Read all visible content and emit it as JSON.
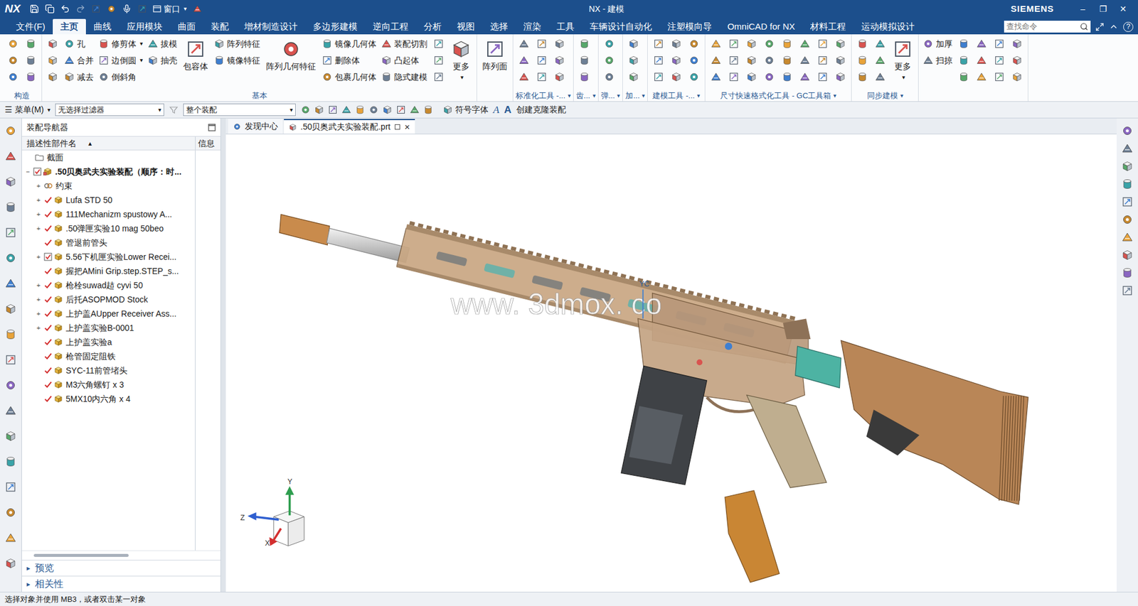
{
  "caret": "▾",
  "window": {
    "logo": "NX",
    "title": "NX - 建模",
    "brand": "SIEMENS",
    "window_menu": "窗口",
    "controls": [
      "–",
      "❐",
      "✕"
    ]
  },
  "tabs": [
    {
      "label": "文件(F)",
      "selected": false
    },
    {
      "label": "主页",
      "selected": true
    },
    {
      "label": "曲线",
      "selected": false
    },
    {
      "label": "应用模块",
      "selected": false
    },
    {
      "label": "曲面",
      "selected": false
    },
    {
      "label": "装配",
      "selected": false
    },
    {
      "label": "增材制造设计",
      "selected": false
    },
    {
      "label": "多边形建模",
      "selected": false
    },
    {
      "label": "逆向工程",
      "selected": false
    },
    {
      "label": "分析",
      "selected": false
    },
    {
      "label": "视图",
      "selected": false
    },
    {
      "label": "选择",
      "selected": false
    },
    {
      "label": "渲染",
      "selected": false
    },
    {
      "label": "工具",
      "selected": false
    },
    {
      "label": "车辆设计自动化",
      "selected": false
    },
    {
      "label": "注塑模向导",
      "selected": false
    },
    {
      "label": "OmniCAD for NX",
      "selected": false
    },
    {
      "label": "材料工程",
      "selected": false
    },
    {
      "label": "运动模拟设计",
      "selected": false
    }
  ],
  "search": {
    "placeholder": "查找命令",
    "help": "?"
  },
  "ribbon": {
    "groups": [
      {
        "label": "构造",
        "columns": [
          {
            "kind": "icons"
          },
          {
            "kind": "icons"
          }
        ]
      },
      {
        "label": "基本",
        "columns": [
          {
            "kind": "icons"
          },
          {
            "kind": "small",
            "items": [
              {
                "label": "孔"
              },
              {
                "label": "合并"
              },
              {
                "label": "减去"
              }
            ]
          },
          {
            "kind": "small",
            "items": [
              {
                "label": "修剪体",
                "dropdown": true
              },
              {
                "label": "边倒圆",
                "dropdown": true
              },
              {
                "label": "倒斜角"
              }
            ]
          },
          {
            "kind": "small",
            "items": [
              {
                "label": "拔模"
              },
              {
                "label": "抽壳"
              }
            ]
          },
          {
            "kind": "large",
            "label": "包容体"
          },
          {
            "kind": "small",
            "items": [
              {
                "label": "阵列特征"
              },
              {
                "label": "镜像特征"
              }
            ]
          },
          {
            "kind": "large",
            "label": "阵列几何特征"
          },
          {
            "kind": "small",
            "items": [
              {
                "label": "镜像几何体"
              },
              {
                "label": "删除体"
              },
              {
                "label": "包裹几何体"
              }
            ]
          },
          {
            "kind": "small",
            "items": [
              {
                "label": "装配切割"
              },
              {
                "label": "凸起体"
              },
              {
                "label": "隐式建模"
              }
            ]
          },
          {
            "kind": "icons"
          },
          {
            "kind": "large",
            "label": "更多",
            "dropdown": true
          }
        ]
      },
      {
        "columns": [
          {
            "kind": "large",
            "label": "阵列面"
          }
        ]
      },
      {
        "label": "标准化工具 -...",
        "dropdown": true,
        "columns": [
          {
            "kind": "icons"
          },
          {
            "kind": "icons"
          },
          {
            "kind": "icons"
          }
        ]
      },
      {
        "label": "齿...",
        "dropdown": true,
        "columns": [
          {
            "kind": "icons"
          }
        ]
      },
      {
        "label": "弹...",
        "dropdown": true,
        "columns": [
          {
            "kind": "icons"
          }
        ]
      },
      {
        "label": "加...",
        "dropdown": true,
        "columns": [
          {
            "kind": "icons"
          }
        ]
      },
      {
        "label": "建模工具 -...",
        "dropdown": true,
        "columns": [
          {
            "kind": "icons"
          },
          {
            "kind": "icons"
          },
          {
            "kind": "icons"
          }
        ]
      },
      {
        "label": "尺寸快速格式化工具 - GC工具箱",
        "dropdown": true,
        "columns": [
          {
            "kind": "icons"
          },
          {
            "kind": "icons"
          },
          {
            "kind": "icons"
          },
          {
            "kind": "icons"
          },
          {
            "kind": "icons"
          },
          {
            "kind": "icons"
          },
          {
            "kind": "icons"
          },
          {
            "kind": "icons"
          }
        ]
      },
      {
        "label": "同步建模",
        "dropdown": true,
        "columns": [
          {
            "kind": "icons"
          },
          {
            "kind": "icons"
          },
          {
            "kind": "large",
            "label": "更多",
            "dropdown": true
          }
        ]
      },
      {
        "columns": [
          {
            "kind": "small",
            "items": [
              {
                "label": "加厚"
              },
              {
                "label": "扫掠"
              }
            ]
          },
          {
            "kind": "icons"
          },
          {
            "kind": "icons"
          },
          {
            "kind": "icons"
          },
          {
            "kind": "icons"
          }
        ]
      }
    ]
  },
  "toolbar": {
    "menu_icon": "☰",
    "menu": "菜单(M)",
    "filters": [
      "无选择过滤器",
      "整个装配"
    ],
    "symbol_font": "符号字体",
    "font_icons": [
      "A",
      "A"
    ],
    "clone": "创建克隆装配"
  },
  "documents": [
    {
      "label": "发现中心",
      "selected": false
    },
    {
      "label": ".50贝奥武夫实验装配.prt",
      "selected": true,
      "close": "✕"
    }
  ],
  "navigator": {
    "title": "装配导航器",
    "columns": [
      "描述性部件名",
      "信息"
    ],
    "sort": "▲",
    "rows": [
      {
        "label": "截面",
        "level": 1,
        "kind": "folder",
        "check": "none",
        "bold": false
      },
      {
        "label": ".50贝奥武夫实验装配（顺序：时...",
        "level": 0,
        "expander": "−",
        "kind": "assembly",
        "check": "box",
        "bold": true
      },
      {
        "label": "约束",
        "level": 1,
        "expander": "+",
        "kind": "constraint",
        "check": "none",
        "bold": false
      },
      {
        "label": "Lufa STD 50",
        "level": 1,
        "expander": "+",
        "kind": "part",
        "check": "tick",
        "bold": false
      },
      {
        "label": "111Mechanizm spustowy A...",
        "level": 1,
        "expander": "+",
        "kind": "part",
        "check": "tick",
        "bold": false
      },
      {
        "label": ".50弹匣实验10 mag 50beo",
        "level": 1,
        "expander": "+",
        "kind": "part",
        "check": "tick",
        "bold": false
      },
      {
        "label": "管退前管头",
        "level": 1,
        "kind": "part",
        "check": "tick",
        "bold": false
      },
      {
        "label": "5.56下机匣实验Lower Recei...",
        "level": 1,
        "expander": "+",
        "kind": "part",
        "check": "box",
        "bold": false
      },
      {
        "label": "握把AMini Grip.step.STEP_s...",
        "level": 1,
        "kind": "part",
        "check": "tick",
        "bold": false
      },
      {
        "label": "枪栓suwad趌 cyvi 50",
        "level": 1,
        "expander": "+",
        "kind": "part",
        "check": "tick",
        "bold": false
      },
      {
        "label": "后托ASOPMOD Stock",
        "level": 1,
        "expander": "+",
        "kind": "part",
        "check": "tick",
        "bold": false
      },
      {
        "label": "上护盖AUpper Receiver Ass...",
        "level": 1,
        "expander": "+",
        "kind": "part",
        "check": "tick",
        "bold": false
      },
      {
        "label": "上护盖实验B-0001",
        "level": 1,
        "expander": "+",
        "kind": "part",
        "check": "tick",
        "bold": false
      },
      {
        "label": "上护盖实验a",
        "level": 1,
        "kind": "part",
        "check": "tick",
        "bold": false
      },
      {
        "label": "枪管固定阻铁",
        "level": 1,
        "kind": "part",
        "check": "tick",
        "bold": false
      },
      {
        "label": "SYC-11前管堵头",
        "level": 1,
        "kind": "part",
        "check": "tick",
        "bold": false
      },
      {
        "label": "M3六角螺钉 x 3",
        "level": 1,
        "kind": "part",
        "check": "tick",
        "bold": false
      },
      {
        "label": "5MX10内六角 x 4",
        "level": 1,
        "kind": "part",
        "check": "tick",
        "bold": false
      }
    ],
    "sections": [
      {
        "label": "预览",
        "expander": "▸"
      },
      {
        "label": "相关性",
        "expander": "▸"
      }
    ]
  },
  "viewport": {
    "watermark": "www. 3dmox. co",
    "wcs_label": "YC",
    "axes": [
      "Y",
      "Z",
      "X"
    ]
  },
  "status_bar": "选择对象并使用 MB3，或者双击某一对象"
}
